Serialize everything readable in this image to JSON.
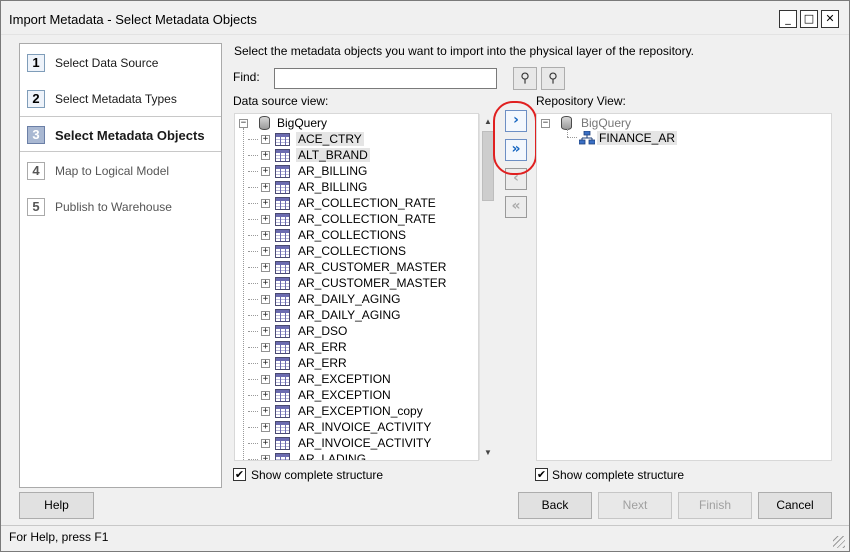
{
  "window": {
    "title": "Import Metadata - Select Metadata Objects",
    "min_glyph": "_",
    "max_glyph": "□",
    "close_glyph": "✕"
  },
  "steps": [
    {
      "num": "1",
      "label": "Select Data Source"
    },
    {
      "num": "2",
      "label": "Select Metadata Types"
    },
    {
      "num": "3",
      "label": "Select Metadata Objects"
    },
    {
      "num": "4",
      "label": "Map to Logical Model"
    },
    {
      "num": "5",
      "label": "Publish to Warehouse"
    }
  ],
  "instruction": "Select the metadata objects you want to import into the physical layer of the repository.",
  "find": {
    "label": "Find:",
    "value": "",
    "placeholder": ""
  },
  "find_buttons": {
    "next_icon": "find-next-icon",
    "prev_icon": "find-prev-icon",
    "glyph": "⚲"
  },
  "data_source_view": {
    "label": "Data source view:",
    "root": "BigQuery",
    "items": [
      "ACE_CTRY",
      "ALT_BRAND",
      "AR_BILLING",
      "AR_BILLING",
      "AR_COLLECTION_RATE",
      "AR_COLLECTION_RATE",
      "AR_COLLECTIONS",
      "AR_COLLECTIONS",
      "AR_CUSTOMER_MASTER",
      "AR_CUSTOMER_MASTER",
      "AR_DAILY_AGING",
      "AR_DAILY_AGING",
      "AR_DSO",
      "AR_ERR",
      "AR_ERR",
      "AR_EXCEPTION",
      "AR_EXCEPTION",
      "AR_EXCEPTION_copy",
      "AR_INVOICE_ACTIVITY",
      "AR_INVOICE_ACTIVITY",
      "AR_LADING"
    ],
    "highlighted": [
      0,
      1
    ]
  },
  "repository_view": {
    "label": "Repository View:",
    "root": "BigQuery",
    "child": "FINANCE_AR"
  },
  "move_buttons": {
    "add": "›",
    "add_all": "»",
    "remove": "‹",
    "remove_all": "«"
  },
  "show_structure": {
    "label": "Show complete structure",
    "checked_glyph": "✔"
  },
  "buttons": {
    "help": "Help",
    "back": "Back",
    "next": "Next",
    "finish": "Finish",
    "cancel": "Cancel"
  },
  "status": "For Help, press F1",
  "colors": {
    "accent": "#1565c0",
    "annotation": "#e02020",
    "step_active": "#a9b8d2"
  }
}
